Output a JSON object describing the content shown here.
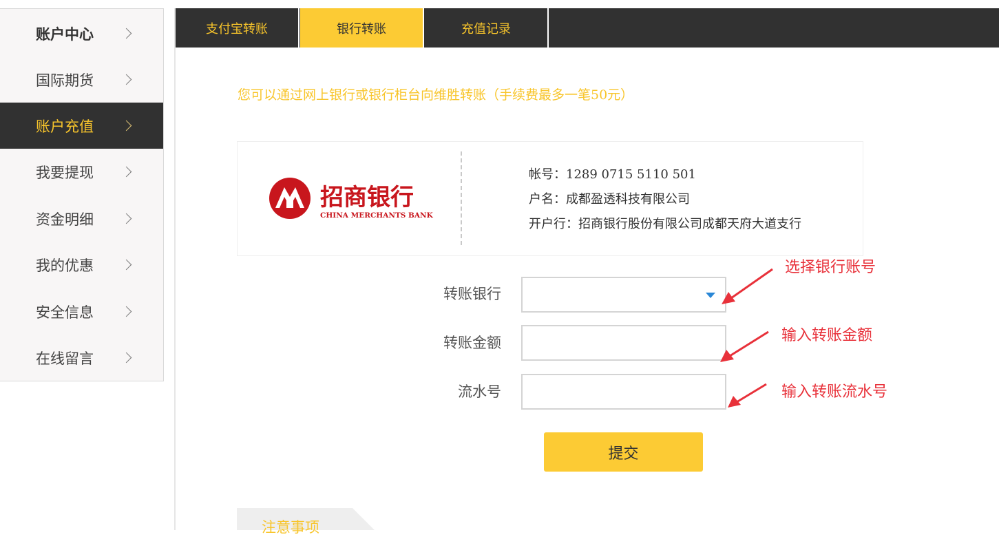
{
  "sidebar": {
    "items": [
      {
        "label": "账户中心"
      },
      {
        "label": "国际期货"
      },
      {
        "label": "账户充值"
      },
      {
        "label": "我要提现"
      },
      {
        "label": "资金明细"
      },
      {
        "label": "我的优惠"
      },
      {
        "label": "安全信息"
      },
      {
        "label": "在线留言"
      }
    ],
    "active_index": 2
  },
  "tabs": [
    {
      "label": "支付宝转账"
    },
    {
      "label": "银行转账"
    },
    {
      "label": "充值记录"
    }
  ],
  "active_tab": 1,
  "notice": "您可以通过网上银行或银行柜台向维胜转账（手续费最多一笔50元）",
  "bank": {
    "logo_name": "招商银行",
    "logo_english": "CHINA MERCHANTS BANK",
    "account": "帐号：1289 0715 5110 501",
    "holder": "户名：成都盈透科技有限公司",
    "branch": "开户行：招商银行股份有限公司成都天府大道支行"
  },
  "form": {
    "bank_label": "转账银行",
    "bank_value": "",
    "amount_label": "转账金额",
    "amount_value": "",
    "serial_label": "流水号",
    "serial_value": "",
    "submit_label": "提交"
  },
  "annotations": {
    "select_bank": "选择银行账号",
    "enter_amount": "输入转账金额",
    "enter_serial": "输入转账流水号"
  },
  "notes_tab_label": "注意事项",
  "colors": {
    "accent": "#fccb34",
    "accent_text": "#f8c52b",
    "dark_bar": "#313131",
    "annotation_red": "#e8313a",
    "logo_red": "#c8161d"
  }
}
